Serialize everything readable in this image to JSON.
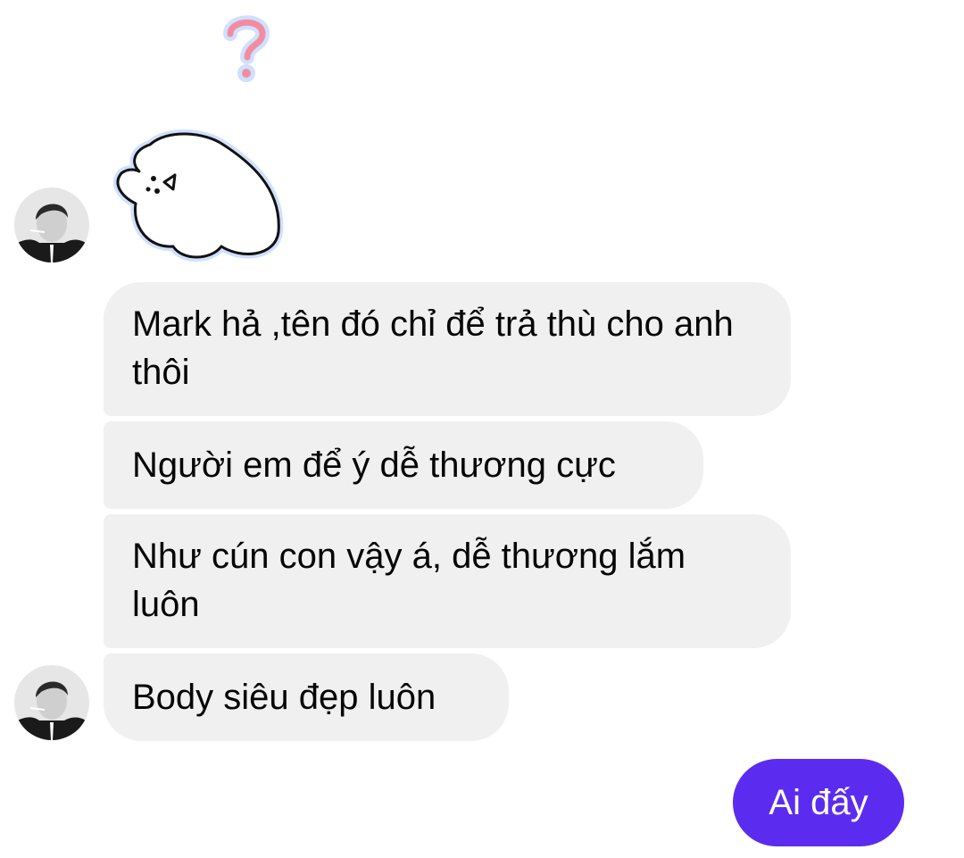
{
  "conversation": {
    "incoming": [
      {
        "text": "Mark hả ,tên đó chỉ để trả thù cho anh thôi"
      },
      {
        "text": "Người em để ý dễ thương cực"
      },
      {
        "text": "Như cún con vậy á, dễ thương lắm luôn"
      },
      {
        "text": "Body siêu đẹp luôn"
      }
    ],
    "outgoing": [
      {
        "text": "Ai đấy"
      }
    ]
  },
  "colors": {
    "incoming_bubble": "#f0f0f1",
    "outgoing_bubble": "#5b2cf0",
    "question_sticker": "#f28ca0"
  },
  "icons": {
    "question_sticker": "question-mark-sticker",
    "blob_sticker": "white-blob-sticker",
    "avatar": "contact-avatar"
  }
}
